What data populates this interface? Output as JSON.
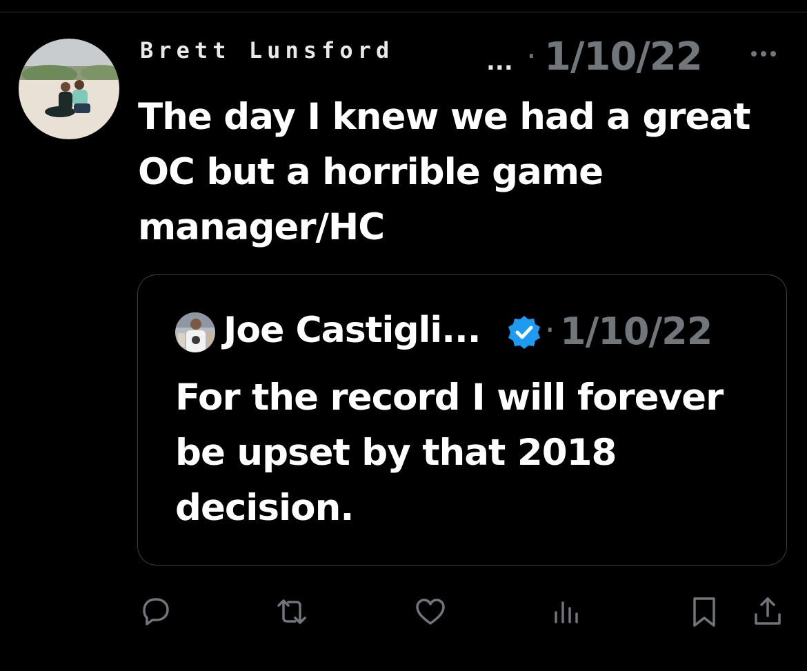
{
  "tweet": {
    "author_name": "Brett Lunsford",
    "name_ellipsis": "...",
    "separator": "·",
    "date": "1/10/22",
    "more_icon": "more-horizontal-icon",
    "text": "The day I knew we had a great OC but a horrible game manager/HC"
  },
  "quoted_tweet": {
    "author_name": "Joe Castigli...",
    "verified": true,
    "separator": "·",
    "date": "1/10/22",
    "text": "For the record I will forever be upset by that 2018 decision."
  },
  "actions": [
    {
      "name": "reply",
      "icon": "reply-icon"
    },
    {
      "name": "retweet",
      "icon": "retweet-icon"
    },
    {
      "name": "like",
      "icon": "heart-icon"
    },
    {
      "name": "views",
      "icon": "analytics-icon"
    },
    {
      "name": "bookmark",
      "icon": "bookmark-icon"
    },
    {
      "name": "share",
      "icon": "share-icon"
    }
  ],
  "colors": {
    "background": "#000000",
    "text_primary": "#ffffff",
    "text_secondary": "#71767b",
    "border": "#3e4144",
    "verified_blue": "#1d9bf0"
  }
}
